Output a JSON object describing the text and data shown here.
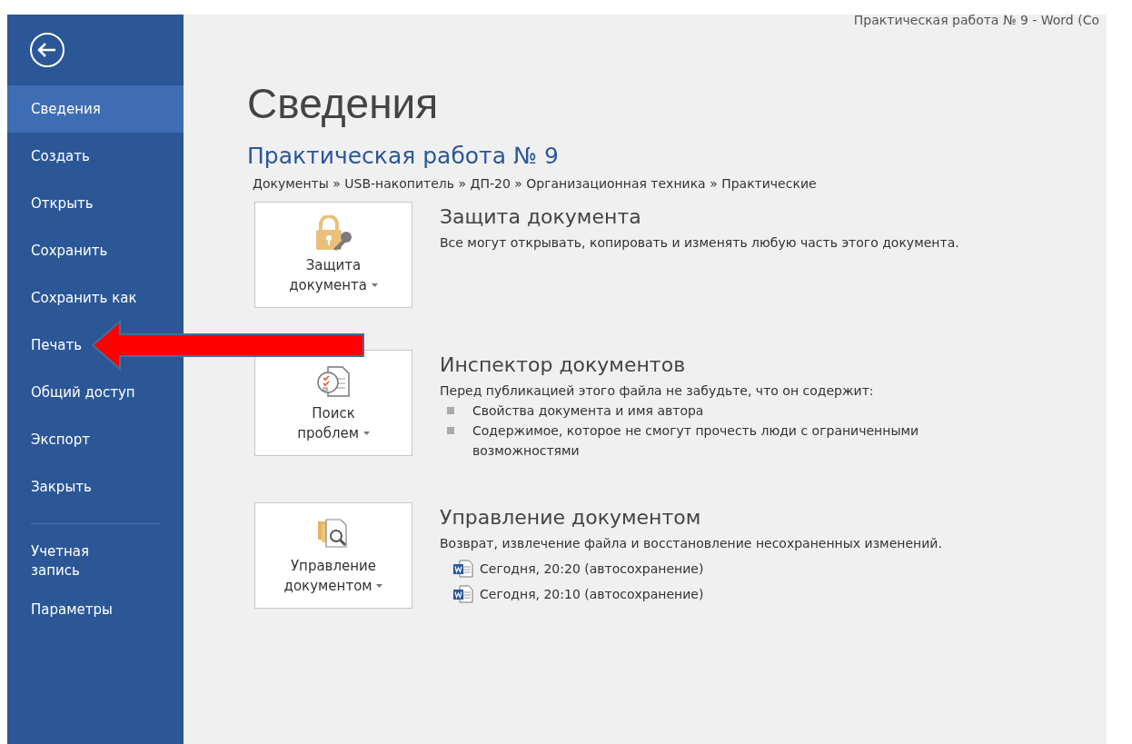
{
  "window": {
    "title": "Практическая работа № 9 - Word (Со"
  },
  "sidebar": {
    "items": [
      {
        "label": "Сведения",
        "selected": true
      },
      {
        "label": "Создать",
        "selected": false
      },
      {
        "label": "Открыть",
        "selected": false
      },
      {
        "label": "Сохранить",
        "selected": false
      },
      {
        "label": "Сохранить как",
        "selected": false
      },
      {
        "label": "Печать",
        "selected": false
      },
      {
        "label": "Общий доступ",
        "selected": false
      },
      {
        "label": "Экспорт",
        "selected": false
      },
      {
        "label": "Закрыть",
        "selected": false
      }
    ],
    "bottom_items": [
      {
        "label": "Учетная запись",
        "selected": false
      },
      {
        "label": "Параметры",
        "selected": false
      }
    ]
  },
  "page": {
    "heading": "Сведения",
    "document_title": "Практическая работа № 9",
    "path": "Документы » USB-накопитель » ДП-20 » Организационная техника » Практические"
  },
  "sections": [
    {
      "kind": "protect",
      "button": [
        "Защита",
        "документа"
      ],
      "title": "Защита документа",
      "description": "Все могут открывать, копировать и изменять любую часть этого документа."
    },
    {
      "kind": "inspect",
      "button": [
        "Поиск",
        "проблем"
      ],
      "title": "Инспектор документов",
      "description": "Перед публикацией этого файла не забудьте, что он содержит:",
      "bullets": [
        "Свойства документа и имя автора",
        "Содержимое, которое не смогут прочесть люди с ограниченными возможностями"
      ]
    },
    {
      "kind": "manage",
      "button": [
        "Управление",
        "документом"
      ],
      "title": "Управление документом",
      "description": "Возврат, извлечение файла и восстановление несохраненных изменений.",
      "versions": [
        "Сегодня, 20:20 (автосохранение)",
        "Сегодня, 20:10 (автосохранение)"
      ]
    }
  ]
}
